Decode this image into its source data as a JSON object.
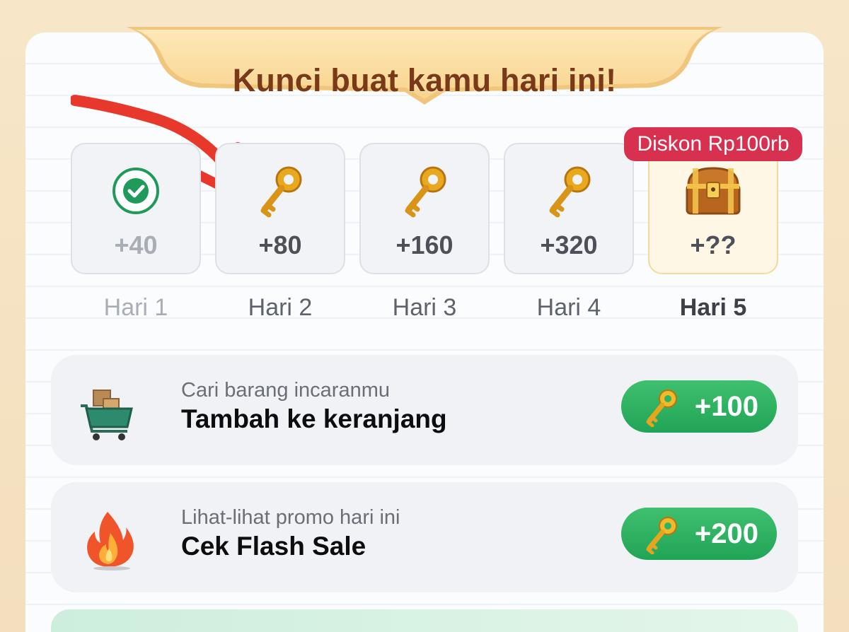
{
  "header": {
    "title": "Kunci buat kamu hari ini!"
  },
  "days": [
    {
      "label": "Hari 1",
      "amount": "+40",
      "icon": "check-icon",
      "state": "done"
    },
    {
      "label": "Hari 2",
      "amount": "+80",
      "icon": "key-icon",
      "state": "current"
    },
    {
      "label": "Hari 3",
      "amount": "+160",
      "icon": "key-icon",
      "state": "upcoming"
    },
    {
      "label": "Hari 4",
      "amount": "+320",
      "icon": "key-icon",
      "state": "upcoming"
    },
    {
      "label": "Hari 5",
      "amount": "+??",
      "icon": "treasure-chest-icon",
      "state": "bonus"
    }
  ],
  "bonus_badge": "Diskon Rp100rb",
  "tasks": [
    {
      "subtitle": "Cari barang incaranmu",
      "title": "Tambah ke keranjang",
      "reward": "+100",
      "icon": "shopping-cart-icon"
    },
    {
      "subtitle": "Lihat-lihat promo hari ini",
      "title": "Cek Flash Sale",
      "reward": "+200",
      "icon": "flame-icon"
    }
  ],
  "colors": {
    "accent_green": "#22a457",
    "badge_red": "#d8304f",
    "title_brown": "#7a3a17",
    "arrow_red": "#e8382c"
  }
}
